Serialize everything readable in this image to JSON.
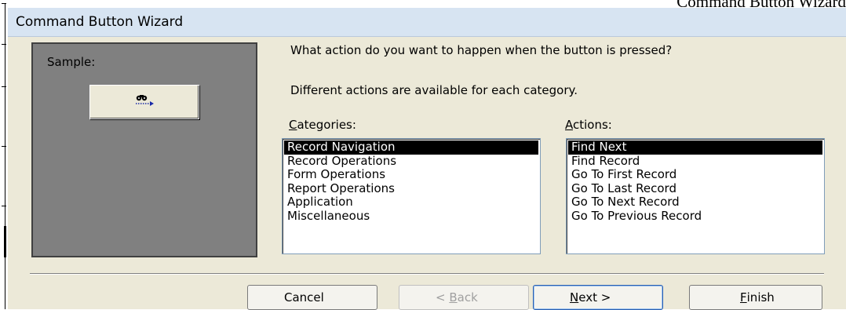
{
  "document": {
    "heading": "Command Button Wizard"
  },
  "dialog": {
    "title": "Command Button Wizard",
    "sample": {
      "label": "Sample:",
      "icon": "find-next-binoculars-icon"
    },
    "prompt": "What action do you want to happen when the button is pressed?",
    "subprompt": "Different actions are available for each category.",
    "categories": {
      "label_accel": "C",
      "label_rest": "ategories:",
      "items": [
        "Record Navigation",
        "Record Operations",
        "Form Operations",
        "Report Operations",
        "Application",
        "Miscellaneous"
      ],
      "selected": "Record Navigation"
    },
    "actions": {
      "label_accel": "A",
      "label_rest": "ctions:",
      "items": [
        "Find Next",
        "Find Record",
        "Go To First Record",
        "Go To Last Record",
        "Go To Next Record",
        "Go To Previous Record"
      ],
      "selected": "Find Next"
    },
    "buttons": {
      "cancel": "Cancel",
      "back_pre": "< ",
      "back_accel": "B",
      "back_rest": "ack",
      "next_accel": "N",
      "next_rest": "ext >",
      "finish_accel": "F",
      "finish_rest": "inish"
    }
  },
  "colors": {
    "dialog_bg": "#ece9d8",
    "title_bg": "#d7e4f2",
    "sample_bg": "#808080",
    "selection": "#000000"
  }
}
